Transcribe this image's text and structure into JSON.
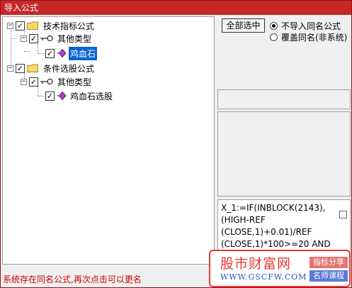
{
  "window": {
    "title": "导入公式"
  },
  "tree": {
    "groups": [
      {
        "label": "技术指标公式",
        "children": [
          {
            "label": "其他类型",
            "children": [
              {
                "label": "鸡血石",
                "selected": true
              }
            ]
          }
        ]
      },
      {
        "label": "条件选股公式",
        "children": [
          {
            "label": "其他类型",
            "children": [
              {
                "label": "鸡血石选股",
                "selected": false
              }
            ]
          }
        ]
      }
    ]
  },
  "controls": {
    "select_all_label": "全部选中",
    "radio_options": [
      {
        "label": "不导入同名公式",
        "checked": true
      },
      {
        "label": "覆盖同名(非系统)",
        "checked": false
      }
    ]
  },
  "formula_preview": {
    "lines": [
      "X_1:=IF(INBLOCK(2143),",
      "(HIGH-REF",
      "(CLOSE,1)+0.01)/REF",
      "(CLOSE,1)*100>=20 AND"
    ]
  },
  "status": {
    "message": "系统存在同名公式,再次点击可以更名"
  },
  "watermark": {
    "name": "股市财富网",
    "url": "WWW.GSCFW.COM",
    "tag1": "指标分享",
    "tag2": "名师课程"
  },
  "colors": {
    "titlebar": "#c62828",
    "selection": "#0a64d2",
    "status_text": "#cc0000",
    "watermark_red": "#e53935",
    "watermark_blue": "#2255cc"
  }
}
